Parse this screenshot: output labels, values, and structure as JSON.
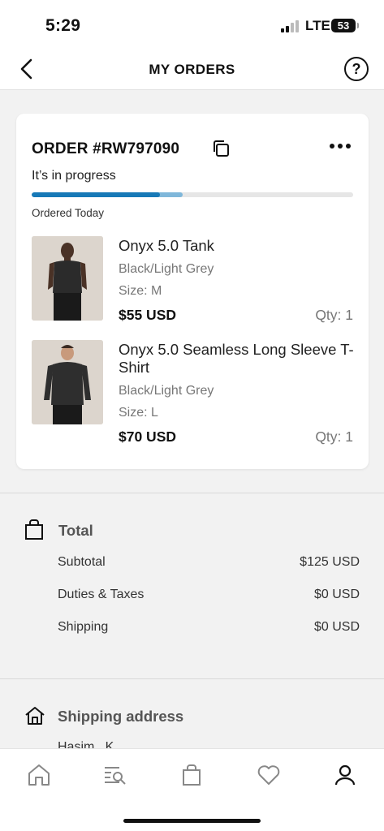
{
  "status_bar": {
    "time": "5:29",
    "network": "LTE",
    "battery": "53"
  },
  "nav": {
    "title": "MY ORDERS",
    "help_icon": "?"
  },
  "order": {
    "id": "ORDER #RW797090",
    "status": "It’s in progress",
    "progress": 0.4,
    "ordered": "Ordered Today",
    "items": [
      {
        "name": "Onyx 5.0 Tank",
        "variant": "Black/Light Grey",
        "size": "Size: M",
        "price": "$55 USD",
        "qty": "Qty: 1"
      },
      {
        "name": "Onyx 5.0 Seamless Long Sleeve T-Shirt",
        "variant": "Black/Light Grey",
        "size": "Size: L",
        "price": "$70 USD",
        "qty": "Qty: 1"
      }
    ]
  },
  "total": {
    "title": "Total",
    "rows": [
      {
        "label": "Subtotal",
        "value": "$125 USD"
      },
      {
        "label": "Duties & Taxes",
        "value": "$0 USD"
      },
      {
        "label": "Shipping",
        "value": "$0 USD"
      }
    ]
  },
  "shipping": {
    "title": "Shipping address",
    "peek": "Hasim_ K"
  },
  "tabs": [
    "home-icon",
    "search-list-icon",
    "bag-icon",
    "heart-icon",
    "account-icon"
  ],
  "colors": {
    "progress": "#1779b7",
    "progress_light": "#7fb7da"
  }
}
